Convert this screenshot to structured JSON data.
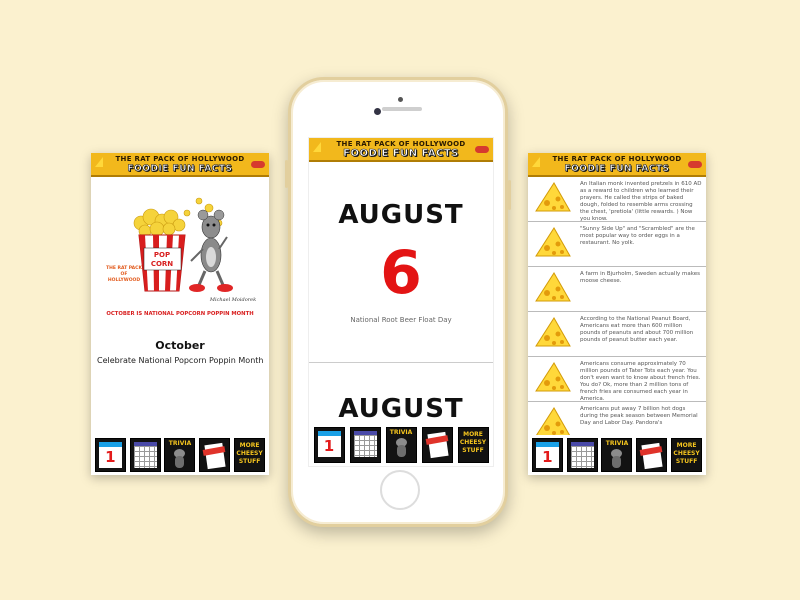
{
  "app": {
    "header_line1": "THE RAT PACK OF HOLLYWOOD",
    "header_line2": "FOODIE FUN FACTS"
  },
  "left_screen": {
    "art_brand": "POP CORN",
    "art_logo": "THE RAT PACK OF HOLLYWOOD",
    "art_signature": "Michael Moidorek",
    "art_caption": "OCTOBER IS NATIONAL POPCORN POPPIN MONTH",
    "month_title": "October",
    "month_description": "Celebrate National Popcorn Poppin Month"
  },
  "center_screen": {
    "month": "AUGUST",
    "day": "6",
    "event": "National Root Beer Float Day",
    "next_month": "AUGUST"
  },
  "right_screen": {
    "facts": [
      "An Italian monk invented pretzels in 610 AD as a reward to children who learned their prayers. He called the strips of baked dough, folded to resemble arms crossing the chest, 'pretiola' (little rewards. ) Now you know.",
      "\"Sunny Side Up\" and \"Scrambled\" are the most popular way to order eggs in a restaurant. No yolk.",
      "A farm in Bjurholm, Sweden actually makes moose cheese.",
      "According to the National Peanut Board, Americans eat more than 600 million pounds of peanuts and about 700 million pounds of peanut butter each year.",
      "Americans consume approximately 70 million pounds of Tater Tots each year. You don't even want to know about french fries. You do? Ok, more than 2 million tons of french fries are consumed each year in America.",
      "Americans put away 7 billion hot dogs during the peak season between Memorial Day and Labor Day. Pandora's"
    ]
  },
  "nav": {
    "calendar_day": "1",
    "trivia_label": "TRIVIA",
    "more_label": "MORE CHEESY STUFF"
  },
  "colors": {
    "background": "#fbf1cf",
    "header": "#f2b81c",
    "accent_red": "#e31414",
    "cheese": "#ffd83a"
  }
}
